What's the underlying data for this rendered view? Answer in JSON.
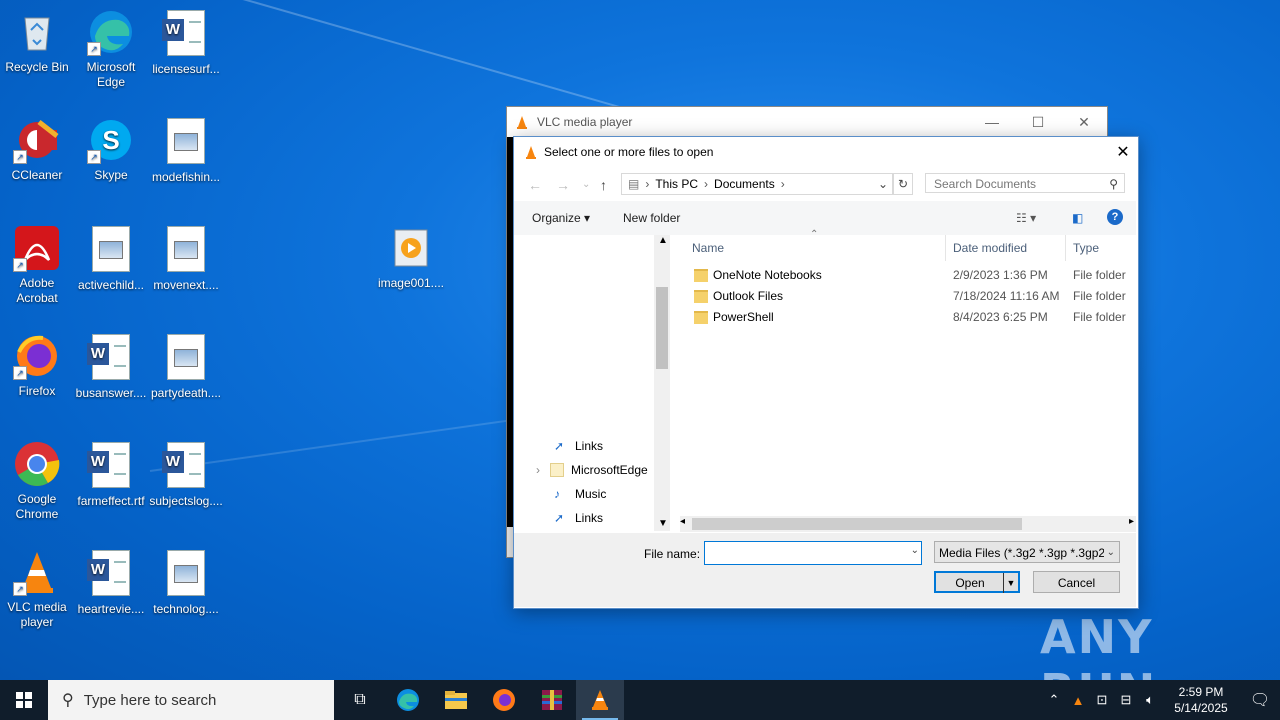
{
  "desktop_icons": [
    {
      "label": "Recycle Bin",
      "icon": "recycle-bin-icon"
    },
    {
      "label": "Microsoft Edge",
      "icon": "edge-icon"
    },
    {
      "label": "licensesurf...",
      "icon": "word-doc-icon"
    },
    {
      "label": "CCleaner",
      "icon": "ccleaner-icon"
    },
    {
      "label": "Skype",
      "icon": "skype-icon"
    },
    {
      "label": "modefishin...",
      "icon": "image-file-icon"
    },
    {
      "label": "Adobe Acrobat",
      "icon": "acrobat-icon"
    },
    {
      "label": "activechild...",
      "icon": "image-file-icon"
    },
    {
      "label": "movenext....",
      "icon": "image-file-icon"
    },
    {
      "label": "image001....",
      "icon": "media-file-icon"
    },
    {
      "label": "Firefox",
      "icon": "firefox-icon"
    },
    {
      "label": "busanswer....",
      "icon": "word-doc-icon"
    },
    {
      "label": "partydeath....",
      "icon": "image-file-icon"
    },
    {
      "label": "Google Chrome",
      "icon": "chrome-icon"
    },
    {
      "label": "farmeffect.rtf",
      "icon": "word-doc-icon"
    },
    {
      "label": "subjectslog....",
      "icon": "word-doc-icon"
    },
    {
      "label": "VLC media player",
      "icon": "vlc-icon"
    },
    {
      "label": "heartrevie....",
      "icon": "word-doc-icon"
    },
    {
      "label": "technolog....",
      "icon": "image-file-icon"
    }
  ],
  "vlc_window": {
    "title": "VLC media player",
    "minimize": "—",
    "maximize": "☐",
    "close": "✕"
  },
  "dialog": {
    "title": "Select one or more files to open",
    "close": "✕",
    "breadcrumb": [
      "This PC",
      "Documents"
    ],
    "search_placeholder": "Search Documents",
    "toolbar": {
      "organize": "Organize",
      "new_folder": "New folder"
    },
    "columns": {
      "name": "Name",
      "date": "Date modified",
      "type": "Type"
    },
    "files": [
      {
        "name": "OneNote Notebooks",
        "date": "2/9/2023 1:36 PM",
        "type": "File folder"
      },
      {
        "name": "Outlook Files",
        "date": "7/18/2024 11:16 AM",
        "type": "File folder"
      },
      {
        "name": "PowerShell",
        "date": "8/4/2023 6:25 PM",
        "type": "File folder"
      }
    ],
    "tree": [
      {
        "label": "Links",
        "icon": "links-icon"
      },
      {
        "label": "MicrosoftEdge",
        "icon": "folder-icon"
      },
      {
        "label": "Music",
        "icon": "music-icon"
      },
      {
        "label": "Links",
        "icon": "links-icon"
      }
    ],
    "file_name_label": "File name:",
    "file_name_value": "",
    "file_type": "Media Files (*.3g2 *.3gp *.3gp2",
    "open_label": "Open",
    "cancel_label": "Cancel"
  },
  "taskbar": {
    "search_placeholder": "Type here to search",
    "time": "2:59 PM",
    "date": "5/14/2025"
  },
  "watermark": "ANY RUN"
}
